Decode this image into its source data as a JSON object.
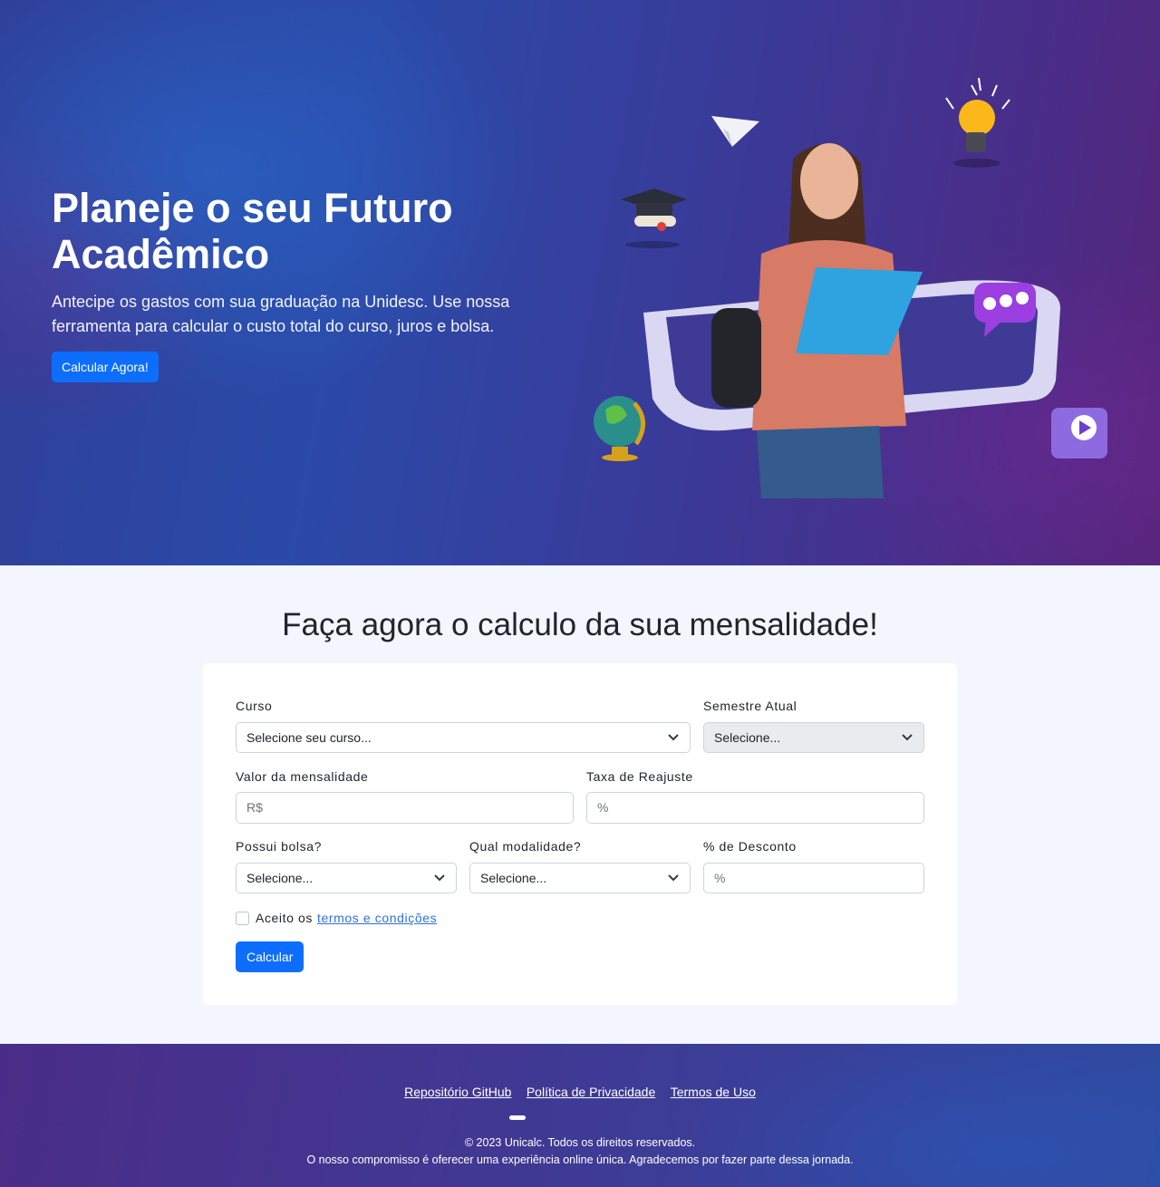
{
  "hero": {
    "title": "Planeje o seu Futuro Acadêmico",
    "subtitle": "Antecipe os gastos com sua graduação na Unidesc. Use nossa ferramenta para calcular o custo total do curso, juros e bolsa.",
    "cta_label": "Calcular Agora!"
  },
  "calculator": {
    "title": "Faça agora o calculo da sua mensalidade!",
    "curso": {
      "label": "Curso",
      "value": "Selecione seu curso..."
    },
    "semestre": {
      "label": "Semestre Atual",
      "value": "Selecione..."
    },
    "mensalidade": {
      "label": "Valor da mensalidade",
      "placeholder": "R$"
    },
    "reajuste": {
      "label": "Taxa de Reajuste",
      "placeholder": "%"
    },
    "bolsa": {
      "label": "Possui bolsa?",
      "value": "Selecione..."
    },
    "modalidade": {
      "label": "Qual modalidade?",
      "value": "Selecione..."
    },
    "desconto": {
      "label": "% de Desconto",
      "placeholder": "%"
    },
    "terms": {
      "prefix": "Aceito os",
      "link": "termos e condições"
    },
    "submit_label": "Calcular"
  },
  "footer": {
    "links": [
      "Repositório GitHub",
      "Política de Privacidade",
      "Termos de Uso"
    ],
    "copyright": "© 2023 Unicalc. Todos os direitos reservados.",
    "tagline": "O nosso compromisso é oferecer uma experiência online única. Agradecemos por fazer parte dessa jornada."
  },
  "colors": {
    "primary": "#0d6efd",
    "hero_blue": "#2b4aa8",
    "hero_purple": "#562578",
    "link": "#2f6fe0"
  },
  "icons": [
    "paper-plane-icon",
    "light-bulb-icon",
    "graduation-cap-icon",
    "globe-icon",
    "chat-bubble-icon",
    "play-icon",
    "chevron-down-icon"
  ]
}
